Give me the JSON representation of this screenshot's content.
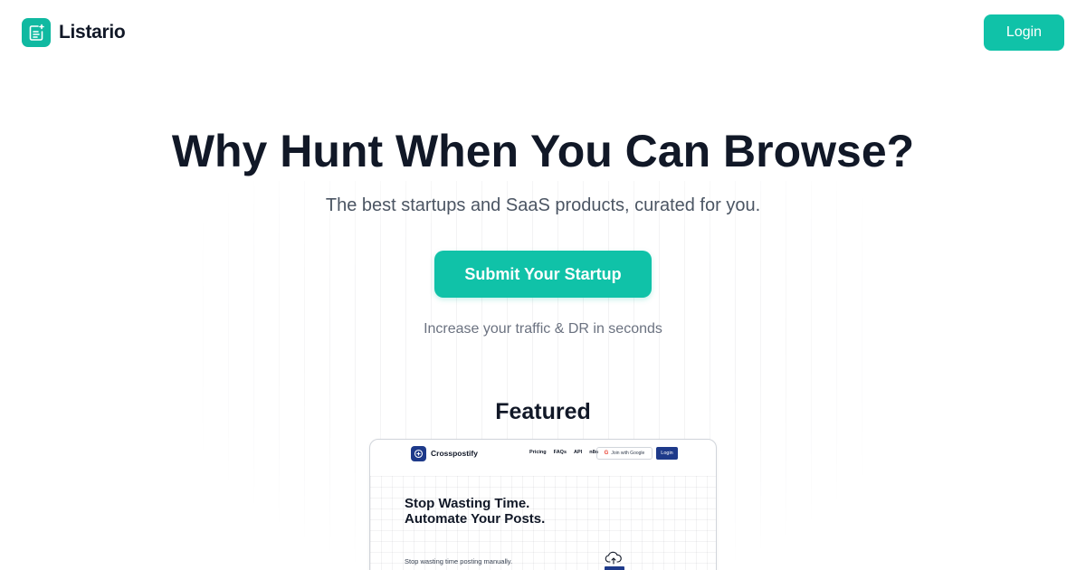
{
  "brand": {
    "name": "Listario"
  },
  "nav": {
    "login_label": "Login"
  },
  "hero": {
    "title": "Why Hunt When You Can Browse?",
    "subtitle": "The best startups and SaaS products, curated for you.",
    "cta_label": "Submit Your Startup",
    "cta_note": "Increase your traffic & DR in seconds"
  },
  "featured": {
    "title": "Featured",
    "card": {
      "brand": "Crosspostify",
      "nav_links": [
        "Pricing",
        "FAQs",
        "API",
        "n8n"
      ],
      "google_label": "Join with Google",
      "login_label": "Login",
      "headline": "Stop Wasting Time. Automate Your Posts.",
      "copy": "Stop wasting time posting manually."
    }
  },
  "colors": {
    "accent": "#10c2a8",
    "text": "#111827",
    "muted": "#6b7280",
    "card_brand": "#1e3a8a"
  },
  "icons": {
    "logo": "note-sparkle-icon",
    "card_logo": "plus-circle-icon",
    "upload": "cloud-upload-icon"
  }
}
